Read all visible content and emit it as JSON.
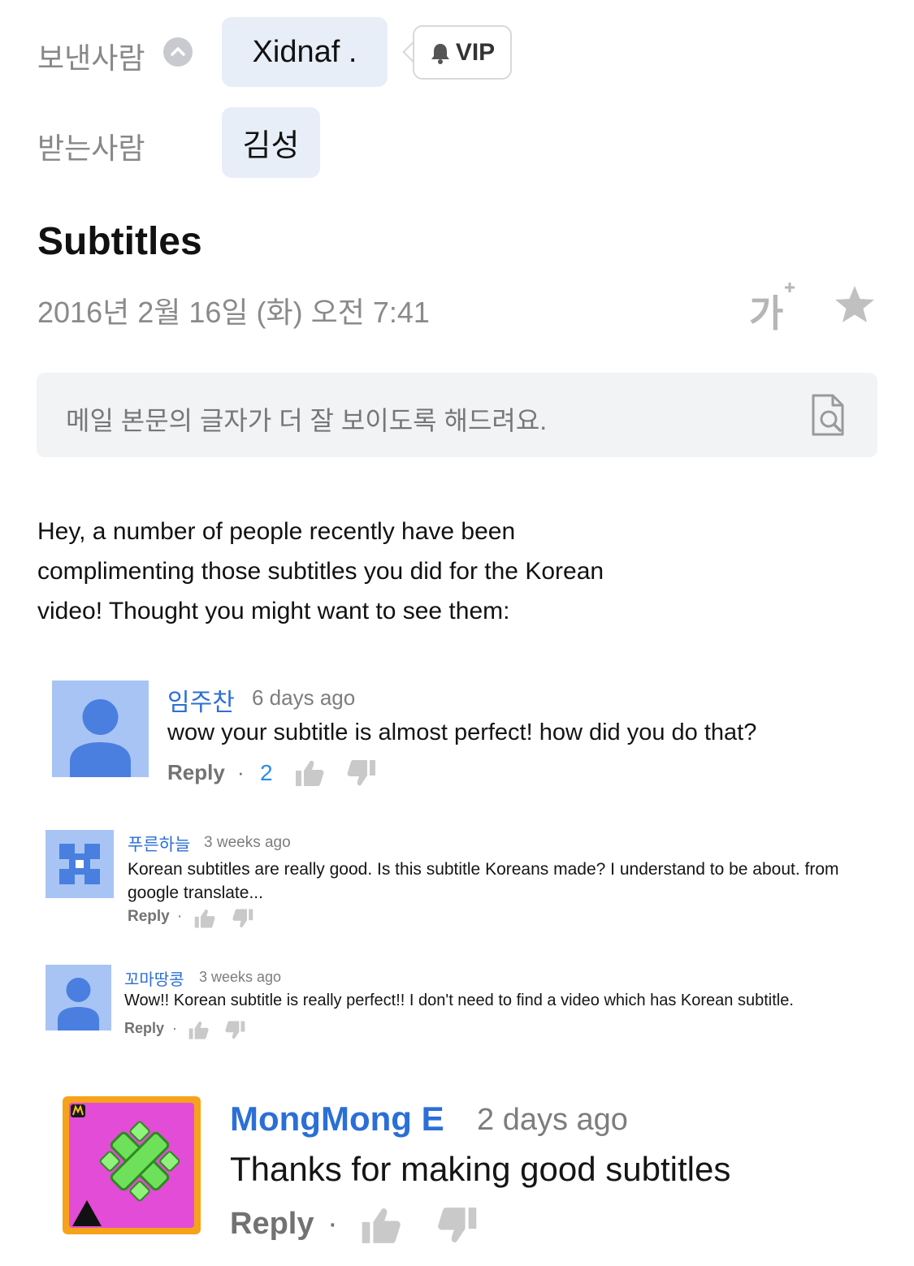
{
  "header": {
    "from_label": "보낸사람",
    "to_label": "받는사람",
    "sender": "Xidnaf .",
    "vip_badge": "VIP",
    "recipient": "김성"
  },
  "email": {
    "subject": "Subtitles",
    "date": "2016년 2월 16일 (화) 오전 7:41",
    "font_size_button": "가",
    "notice": "메일 본문의 글자가 더 잘 보이도록 해드려요.",
    "body": "Hey, a number of people recently have been complimenting those subtitles you did for the Korean video!  Thought you might want to see them:"
  },
  "comments": [
    {
      "author": "임주찬",
      "time": "6 days ago",
      "text": "wow your subtitle is almost perfect! how did you do that?",
      "reply": "Reply",
      "dot": "·",
      "likes": "2"
    },
    {
      "author": "푸른하늘",
      "time": "3 weeks ago",
      "text": "Korean subtitles are really good. Is this subtitle Koreans made? I understand to be about. from google translate...",
      "reply": "Reply",
      "dot": "·"
    },
    {
      "author": "꼬마땅콩",
      "time": "3 weeks ago",
      "text": "Wow!! Korean subtitle is really perfect!! I don't need to find a video which has Korean subtitle.",
      "reply": "Reply",
      "dot": "·"
    },
    {
      "author": "MongMong E",
      "time": "2 days ago",
      "text": "Thanks for making good subtitles",
      "reply": "Reply",
      "dot": "·"
    }
  ],
  "colors": {
    "chip_bg": "#e8eef8",
    "author_blue": "#2b6fd6",
    "avatar_bg": "#a8c4f5",
    "avatar_fg": "#4a7fe0"
  }
}
